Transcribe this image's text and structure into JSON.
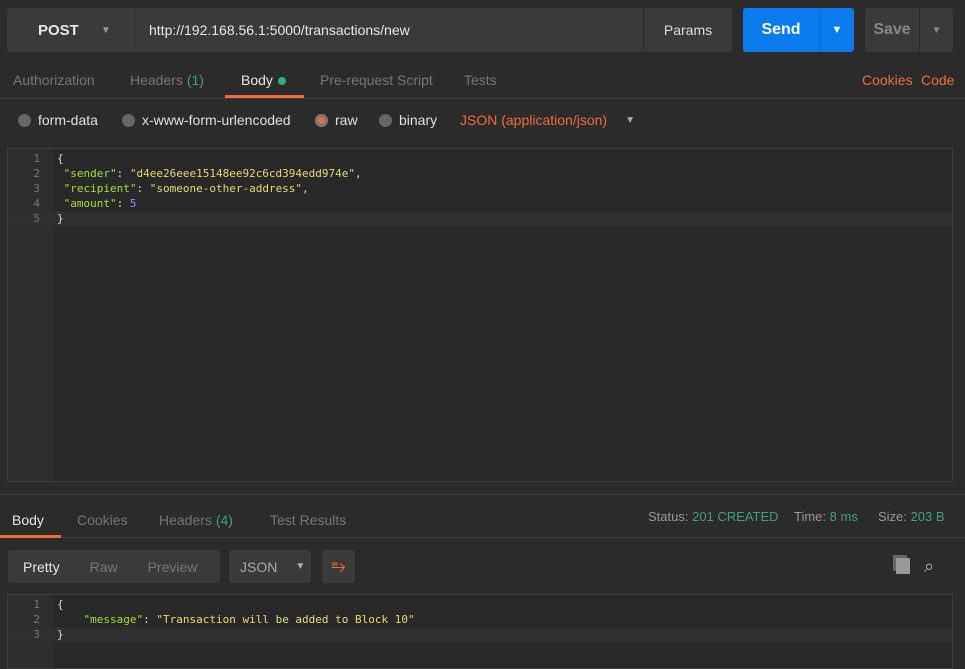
{
  "request": {
    "method": "POST",
    "url": "http://192.168.56.1:5000/transactions/new",
    "params_label": "Params",
    "send_label": "Send",
    "save_label": "Save"
  },
  "tabs": {
    "authorization": "Authorization",
    "headers": "Headers",
    "headers_count": "(1)",
    "body": "Body",
    "prerequest": "Pre-request Script",
    "tests": "Tests",
    "cookies": "Cookies",
    "code": "Code"
  },
  "body_modes": {
    "form_data": "form-data",
    "urlencoded": "x-www-form-urlencoded",
    "raw": "raw",
    "binary": "binary",
    "content_type": "JSON (application/json)",
    "selected": "raw"
  },
  "request_body": {
    "lines": [
      "1",
      "2",
      "3",
      "4",
      "5"
    ],
    "sender_key": "\"sender\"",
    "sender_val": "\"d4ee26eee15148ee92c6cd394edd974e\"",
    "recipient_key": "\"recipient\"",
    "recipient_val": "\"someone-other-address\"",
    "amount_key": "\"amount\"",
    "amount_val": "5",
    "open": "{",
    "close": "}"
  },
  "response_tabs": {
    "body": "Body",
    "cookies": "Cookies",
    "headers": "Headers",
    "headers_count": "(4)",
    "test_results": "Test Results"
  },
  "response_status": {
    "status_label": "Status:",
    "status": "201 CREATED",
    "time_label": "Time:",
    "time": "8 ms",
    "size_label": "Size:",
    "size": "203 B"
  },
  "response_view": {
    "pretty": "Pretty",
    "raw": "Raw",
    "preview": "Preview",
    "format": "JSON"
  },
  "response_body": {
    "lines": [
      "1",
      "2",
      "3"
    ],
    "open": "{",
    "message_key": "\"message\"",
    "message_val": "\"Transaction will be added to Block 10\"",
    "close": "}"
  },
  "colors": {
    "accent": "#f26b3a",
    "send": "#097bed",
    "success": "#3fa27a"
  }
}
